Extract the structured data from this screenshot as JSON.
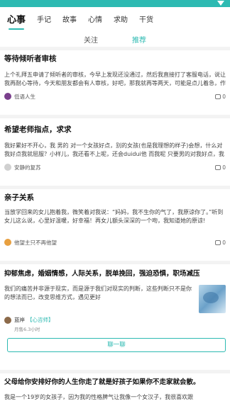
{
  "categories": [
    "心事",
    "手记",
    "故事",
    "心情",
    "求助",
    "干货"
  ],
  "sub_tabs": [
    "关注",
    "推荐"
  ],
  "cards": [
    {
      "title": "等待倾听者审核",
      "body": "上个礼拜五申请了倾听者的审核，今早上发现还没通过，然后我直接打了客服电话，说让我再耐心等待，今天和朋友都会有人审核，好吧，那我就再等两天，可能是点儿着急，作为一个心理学爱好者，想要走咨询师这条路，需...",
      "author": "低语人生",
      "comments": "0",
      "avatar_color": "#7a3f8c"
    },
    {
      "title": "希望老师指点，求求",
      "body": "我好累好不开心，我 男的 对一个女孩好点，别的女孩(也是我理想的样子)会想，什么对我好点我就屈服？小样儿，我还看不上呢，还会duidui他 而我呢 只要男的对我好点，我就奶bu的不行，我 也是觉得大多数男...",
      "author": "安静的复苏",
      "comments": "0",
      "avatar_color": "#d0d0d0"
    },
    {
      "title": "亲子关系",
      "body": "当放学回来的女儿抱着我，微笑着对我说：“妈妈，我不生你的气了，我原谅你了。”听到女儿这么说，心里好温暖，好幸福！再女儿额头深深的一个吻，我知道她的原谅!",
      "author": "他望主只不再他望",
      "comments": "0",
      "avatar_color": "#e8a040"
    }
  ],
  "ad": {
    "title": "抑郁焦虑，婚姻情感，人际关系，脱单挽回，强迫恐惧，职场减压",
    "body": "我们的痛苦并非源于现实，而是源于我们对现实的判断，这些判断只不是你的想法而已，改变思维方式，遇见更好",
    "author": "蓝岸",
    "tag": "【心咨师】",
    "sub": "月售6.3小时",
    "button": "聊一聊"
  },
  "last_card": {
    "title": "父母给你安排好你的人生你走了就是好孩子如果你不走家就会散。",
    "body": "我是一个19岁的女孩子，因为我的性格脾气让我像一个女汉子，我很喜欢跟"
  }
}
